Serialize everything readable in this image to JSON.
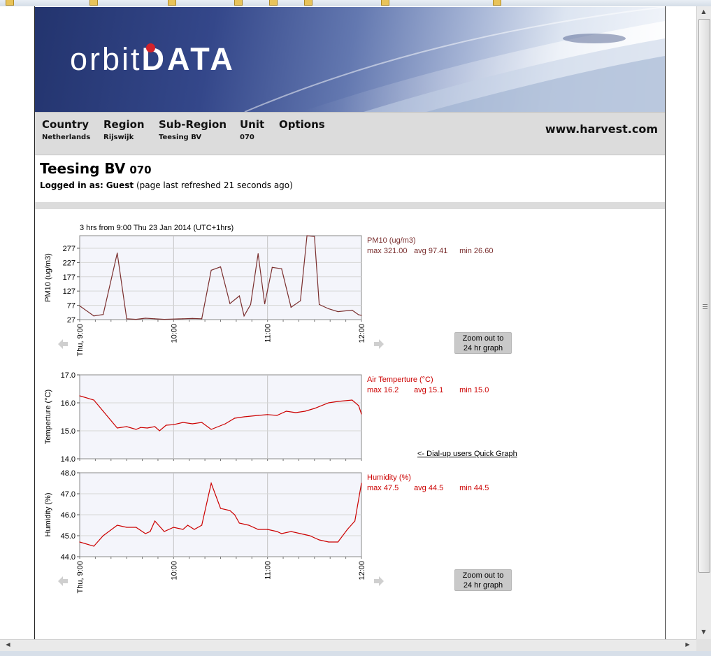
{
  "logo": {
    "part1": "orbit",
    "part2": "DATA"
  },
  "nav": {
    "items": [
      {
        "label": "Country",
        "value": "Netherlands"
      },
      {
        "label": "Region",
        "value": "Rijswijk"
      },
      {
        "label": "Sub-Region",
        "value": "Teesing BV"
      },
      {
        "label": "Unit",
        "value": "070"
      },
      {
        "label": "Options",
        "value": ""
      }
    ],
    "site": "www.harvest.com"
  },
  "site": {
    "name": "Teesing BV",
    "unit": "070"
  },
  "login": {
    "label": "Logged in as:",
    "user": "Guest",
    "refresh_note": "(page last refreshed 21 seconds ago)"
  },
  "graph": {
    "caption": "3 hrs from 9:00 Thu 23 Jan 2014  (UTC+1hrs)",
    "zoom_label_1": "Zoom out to",
    "zoom_label_2": "24 hr graph",
    "dialup_link": "<- Dial-up users Quick Graph"
  },
  "legends": [
    {
      "title": "PM10 (ug/m3)",
      "max": "max 321.00",
      "avg": "avg 97.41",
      "min": "min 26.60",
      "color": "#7a2e2e"
    },
    {
      "title": "Air Temperture (°C)",
      "max": "max 16.2",
      "avg": "avg 15.1",
      "min": "min 15.0",
      "color": "#cc0000"
    },
    {
      "title": "Humidity (%)",
      "max": "max 47.5",
      "avg": "avg 44.5",
      "min": "min 44.5",
      "color": "#cc0000"
    }
  ],
  "chart_data": [
    {
      "type": "line",
      "ylabel": "PM10 (ug/m3)",
      "ylim": [
        27,
        321
      ],
      "yticks": [
        "27",
        "77",
        "127",
        "177",
        "227",
        "277"
      ],
      "xlim": [
        0,
        3
      ],
      "xtick_labels": [
        "Thu, 9:00",
        "10:00",
        "11:00",
        "12:00"
      ],
      "color": "#7a2e2e",
      "series": [
        {
          "x": [
            0,
            0.15,
            0.25,
            0.4,
            0.5,
            0.6,
            0.7,
            0.8,
            0.9,
            1.0,
            1.1,
            1.2,
            1.3,
            1.4,
            1.5,
            1.6,
            1.7,
            1.75,
            1.82,
            1.9,
            1.97,
            2.05,
            2.15,
            2.25,
            2.35,
            2.42,
            2.5,
            2.55,
            2.65,
            2.75,
            2.9,
            2.97,
            3.0
          ],
          "y": [
            75,
            40,
            45,
            260,
            30,
            28,
            32,
            30,
            28,
            29,
            30,
            31,
            30,
            200,
            212,
            83,
            110,
            40,
            80,
            258,
            82,
            210,
            205,
            70,
            93,
            321,
            318,
            80,
            65,
            55,
            60,
            44,
            42
          ]
        }
      ]
    },
    {
      "type": "line",
      "ylabel": "Temperture (°C)",
      "ylim": [
        14.0,
        17.0
      ],
      "yticks": [
        "14.0",
        "15.0",
        "16.0",
        "17.0"
      ],
      "xlim": [
        0,
        3
      ],
      "color": "#cc0000",
      "series": [
        {
          "x": [
            0,
            0.15,
            0.25,
            0.4,
            0.5,
            0.6,
            0.65,
            0.72,
            0.8,
            0.85,
            0.92,
            1.0,
            1.1,
            1.2,
            1.3,
            1.4,
            1.55,
            1.65,
            1.75,
            1.9,
            2.0,
            2.1,
            2.2,
            2.3,
            2.4,
            2.5,
            2.65,
            2.75,
            2.9,
            2.97,
            3.0
          ],
          "y": [
            16.25,
            16.1,
            15.7,
            15.1,
            15.15,
            15.05,
            15.12,
            15.1,
            15.15,
            15.0,
            15.2,
            15.22,
            15.3,
            15.25,
            15.3,
            15.05,
            15.25,
            15.45,
            15.5,
            15.55,
            15.58,
            15.55,
            15.7,
            15.65,
            15.7,
            15.8,
            16.0,
            16.05,
            16.1,
            15.9,
            15.6
          ]
        }
      ]
    },
    {
      "type": "line",
      "ylabel": "Humidity (%)",
      "ylim": [
        44.0,
        48.0
      ],
      "yticks": [
        "44.0",
        "45.0",
        "46.0",
        "47.0",
        "48.0"
      ],
      "xlim": [
        0,
        3
      ],
      "xtick_labels": [
        "Thu, 9:00",
        "10:00",
        "11:00",
        "12:00"
      ],
      "color": "#cc0000",
      "series": [
        {
          "x": [
            0,
            0.15,
            0.25,
            0.4,
            0.5,
            0.6,
            0.7,
            0.75,
            0.8,
            0.9,
            1.0,
            1.1,
            1.15,
            1.22,
            1.3,
            1.4,
            1.5,
            1.6,
            1.65,
            1.7,
            1.8,
            1.9,
            2.0,
            2.1,
            2.15,
            2.25,
            2.35,
            2.45,
            2.5,
            2.55,
            2.65,
            2.75,
            2.85,
            2.93,
            3.0
          ],
          "y": [
            44.7,
            44.5,
            45.0,
            45.5,
            45.4,
            45.4,
            45.1,
            45.2,
            45.7,
            45.2,
            45.4,
            45.3,
            45.5,
            45.3,
            45.5,
            47.5,
            46.3,
            46.2,
            46.0,
            45.6,
            45.5,
            45.3,
            45.3,
            45.2,
            45.1,
            45.2,
            45.1,
            45.0,
            44.9,
            44.8,
            44.7,
            44.7,
            45.3,
            45.7,
            47.5
          ]
        }
      ]
    }
  ]
}
